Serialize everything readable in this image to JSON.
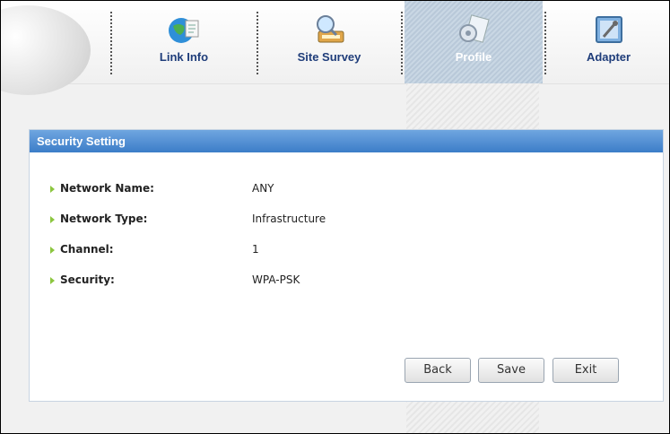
{
  "tabs": [
    {
      "label": "Link Info",
      "icon": "globe-document-icon"
    },
    {
      "label": "Site Survey",
      "icon": "magnifier-network-icon"
    },
    {
      "label": "Profile",
      "icon": "gear-document-icon",
      "active": true
    },
    {
      "label": "Adapter",
      "icon": "adapter-tool-icon"
    }
  ],
  "panel": {
    "title": "Security Setting",
    "fields": [
      {
        "label": "Network Name:",
        "value": "ANY"
      },
      {
        "label": "Network Type:",
        "value": "Infrastructure"
      },
      {
        "label": "Channel:",
        "value": "1"
      },
      {
        "label": "Security:",
        "value": "WPA-PSK"
      }
    ]
  },
  "buttons": {
    "back": "Back",
    "save": "Save",
    "exit": "Exit"
  },
  "colors": {
    "accent": "#3c7dc8",
    "tab_label": "#1f3d7a",
    "bullet": "#8cc63f"
  }
}
